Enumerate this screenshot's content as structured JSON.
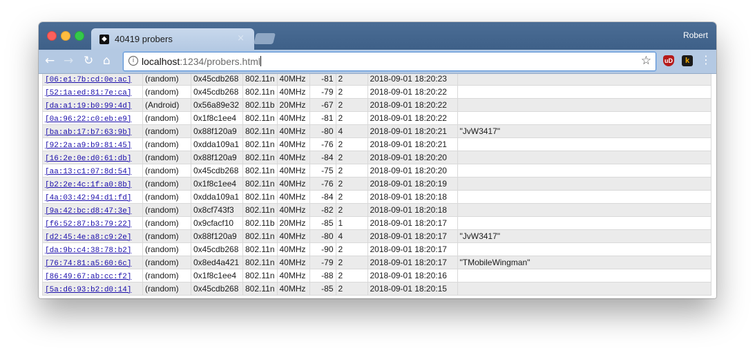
{
  "window": {
    "tab_title": "40419 probers",
    "tab_close": "×",
    "user_name": "Robert"
  },
  "toolbar": {
    "back_glyph": "←",
    "forward_glyph": "→",
    "reload_glyph": "↻",
    "home_glyph": "⌂",
    "url_host": "localhost",
    "url_rest": ":1234/probers.html",
    "bookmark_glyph": "☆",
    "ext_ublock": "uD",
    "ext_k": "k",
    "menu_glyph": "⋮"
  },
  "table": {
    "rows": [
      {
        "mac": "[06:e1:7b:cd:0e:ac]",
        "vendor": "(random)",
        "hash": "0x45cdb268",
        "std": "802.11n",
        "bw": "40MHz",
        "rssi": "-81",
        "count": "2",
        "time": "2018-09-01 18:20:23",
        "ssid": ""
      },
      {
        "mac": "[52:1a:ed:81:7e:ca]",
        "vendor": "(random)",
        "hash": "0x45cdb268",
        "std": "802.11n",
        "bw": "40MHz",
        "rssi": "-79",
        "count": "2",
        "time": "2018-09-01 18:20:22",
        "ssid": ""
      },
      {
        "mac": "[da:a1:19:b0:99:4d]",
        "vendor": "(Android)",
        "hash": "0x56a89e32",
        "std": "802.11b",
        "bw": "20MHz",
        "rssi": "-67",
        "count": "2",
        "time": "2018-09-01 18:20:22",
        "ssid": ""
      },
      {
        "mac": "[0a:96:22:c0:eb:e9]",
        "vendor": "(random)",
        "hash": "0x1f8c1ee4",
        "std": "802.11n",
        "bw": "40MHz",
        "rssi": "-81",
        "count": "2",
        "time": "2018-09-01 18:20:22",
        "ssid": ""
      },
      {
        "mac": "[ba:ab:17:b7:63:9b]",
        "vendor": "(random)",
        "hash": "0x88f120a9",
        "std": "802.11n",
        "bw": "40MHz",
        "rssi": "-80",
        "count": "4",
        "time": "2018-09-01 18:20:21",
        "ssid": "\"JvW3417\""
      },
      {
        "mac": "[92:2a:a9:b9:81:45]",
        "vendor": "(random)",
        "hash": "0xdda109a1",
        "std": "802.11n",
        "bw": "40MHz",
        "rssi": "-76",
        "count": "2",
        "time": "2018-09-01 18:20:21",
        "ssid": ""
      },
      {
        "mac": "[16:2e:0e:d0:61:db]",
        "vendor": "(random)",
        "hash": "0x88f120a9",
        "std": "802.11n",
        "bw": "40MHz",
        "rssi": "-84",
        "count": "2",
        "time": "2018-09-01 18:20:20",
        "ssid": ""
      },
      {
        "mac": "[aa:13:c1:07:8d:54]",
        "vendor": "(random)",
        "hash": "0x45cdb268",
        "std": "802.11n",
        "bw": "40MHz",
        "rssi": "-75",
        "count": "2",
        "time": "2018-09-01 18:20:20",
        "ssid": ""
      },
      {
        "mac": "[b2:2e:4c:1f:a0:8b]",
        "vendor": "(random)",
        "hash": "0x1f8c1ee4",
        "std": "802.11n",
        "bw": "40MHz",
        "rssi": "-76",
        "count": "2",
        "time": "2018-09-01 18:20:19",
        "ssid": ""
      },
      {
        "mac": "[4a:03:42:94:d1:fd]",
        "vendor": "(random)",
        "hash": "0xdda109a1",
        "std": "802.11n",
        "bw": "40MHz",
        "rssi": "-84",
        "count": "2",
        "time": "2018-09-01 18:20:18",
        "ssid": ""
      },
      {
        "mac": "[9a:42:bc:d8:47:3e]",
        "vendor": "(random)",
        "hash": "0x8cf743f3",
        "std": "802.11n",
        "bw": "40MHz",
        "rssi": "-82",
        "count": "2",
        "time": "2018-09-01 18:20:18",
        "ssid": ""
      },
      {
        "mac": "[f6:52:87:b3:79:22]",
        "vendor": "(random)",
        "hash": "0x9cfacf10",
        "std": "802.11b",
        "bw": "20MHz",
        "rssi": "-85",
        "count": "1",
        "time": "2018-09-01 18:20:17",
        "ssid": ""
      },
      {
        "mac": "[d2:45:4e:a8:c9:2e]",
        "vendor": "(random)",
        "hash": "0x88f120a9",
        "std": "802.11n",
        "bw": "40MHz",
        "rssi": "-80",
        "count": "4",
        "time": "2018-09-01 18:20:17",
        "ssid": "\"JvW3417\""
      },
      {
        "mac": "[da:9b:c4:38:78:b2]",
        "vendor": "(random)",
        "hash": "0x45cdb268",
        "std": "802.11n",
        "bw": "40MHz",
        "rssi": "-90",
        "count": "2",
        "time": "2018-09-01 18:20:17",
        "ssid": ""
      },
      {
        "mac": "[76:74:81:a5:60:6c]",
        "vendor": "(random)",
        "hash": "0x8ed4a421",
        "std": "802.11n",
        "bw": "40MHz",
        "rssi": "-79",
        "count": "2",
        "time": "2018-09-01 18:20:17",
        "ssid": "\"TMobileWingman\""
      },
      {
        "mac": "[86:49:67:ab:cc:f2]",
        "vendor": "(random)",
        "hash": "0x1f8c1ee4",
        "std": "802.11n",
        "bw": "40MHz",
        "rssi": "-88",
        "count": "2",
        "time": "2018-09-01 18:20:16",
        "ssid": ""
      },
      {
        "mac": "[5a:d6:93:b2:d0:14]",
        "vendor": "(random)",
        "hash": "0x45cdb268",
        "std": "802.11n",
        "bw": "40MHz",
        "rssi": "-85",
        "count": "2",
        "time": "2018-09-01 18:20:15",
        "ssid": ""
      }
    ]
  }
}
